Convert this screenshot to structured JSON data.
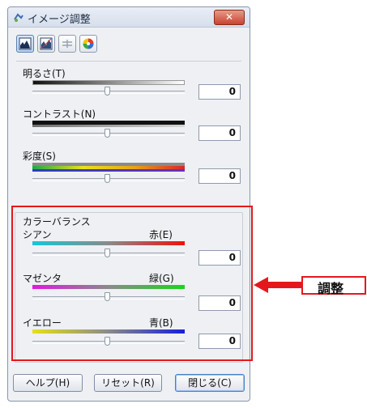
{
  "window": {
    "title": "イメージ調整",
    "close_glyph": "✕"
  },
  "toolbar": {
    "buttons": [
      {
        "icon": "histogram-icon",
        "active": true
      },
      {
        "icon": "tone-curve-icon",
        "active": false
      },
      {
        "icon": "level-lines-icon",
        "active": false
      },
      {
        "icon": "color-palette-icon",
        "active": false
      }
    ]
  },
  "brightness": {
    "label": "明るさ(T)",
    "value": "0"
  },
  "contrast": {
    "label": "コントラスト(N)",
    "value": "0"
  },
  "saturation": {
    "label": "彩度(S)",
    "value": "0"
  },
  "color_balance": {
    "group_label": "カラーバランス",
    "cyan_red": {
      "left": "シアン",
      "right": "赤(E)",
      "value": "0"
    },
    "magenta_green": {
      "left": "マゼンタ",
      "right": "緑(G)",
      "value": "0"
    },
    "yellow_blue": {
      "left": "イエロー",
      "right": "青(B)",
      "value": "0"
    }
  },
  "footer": {
    "help": "ヘルプ(H)",
    "reset": "リセット(R)",
    "close": "閉じる(C)"
  },
  "callout": {
    "label": "調整"
  },
  "colors": {
    "highlight": "#e4181c",
    "window_bg": "#eef0f3"
  }
}
